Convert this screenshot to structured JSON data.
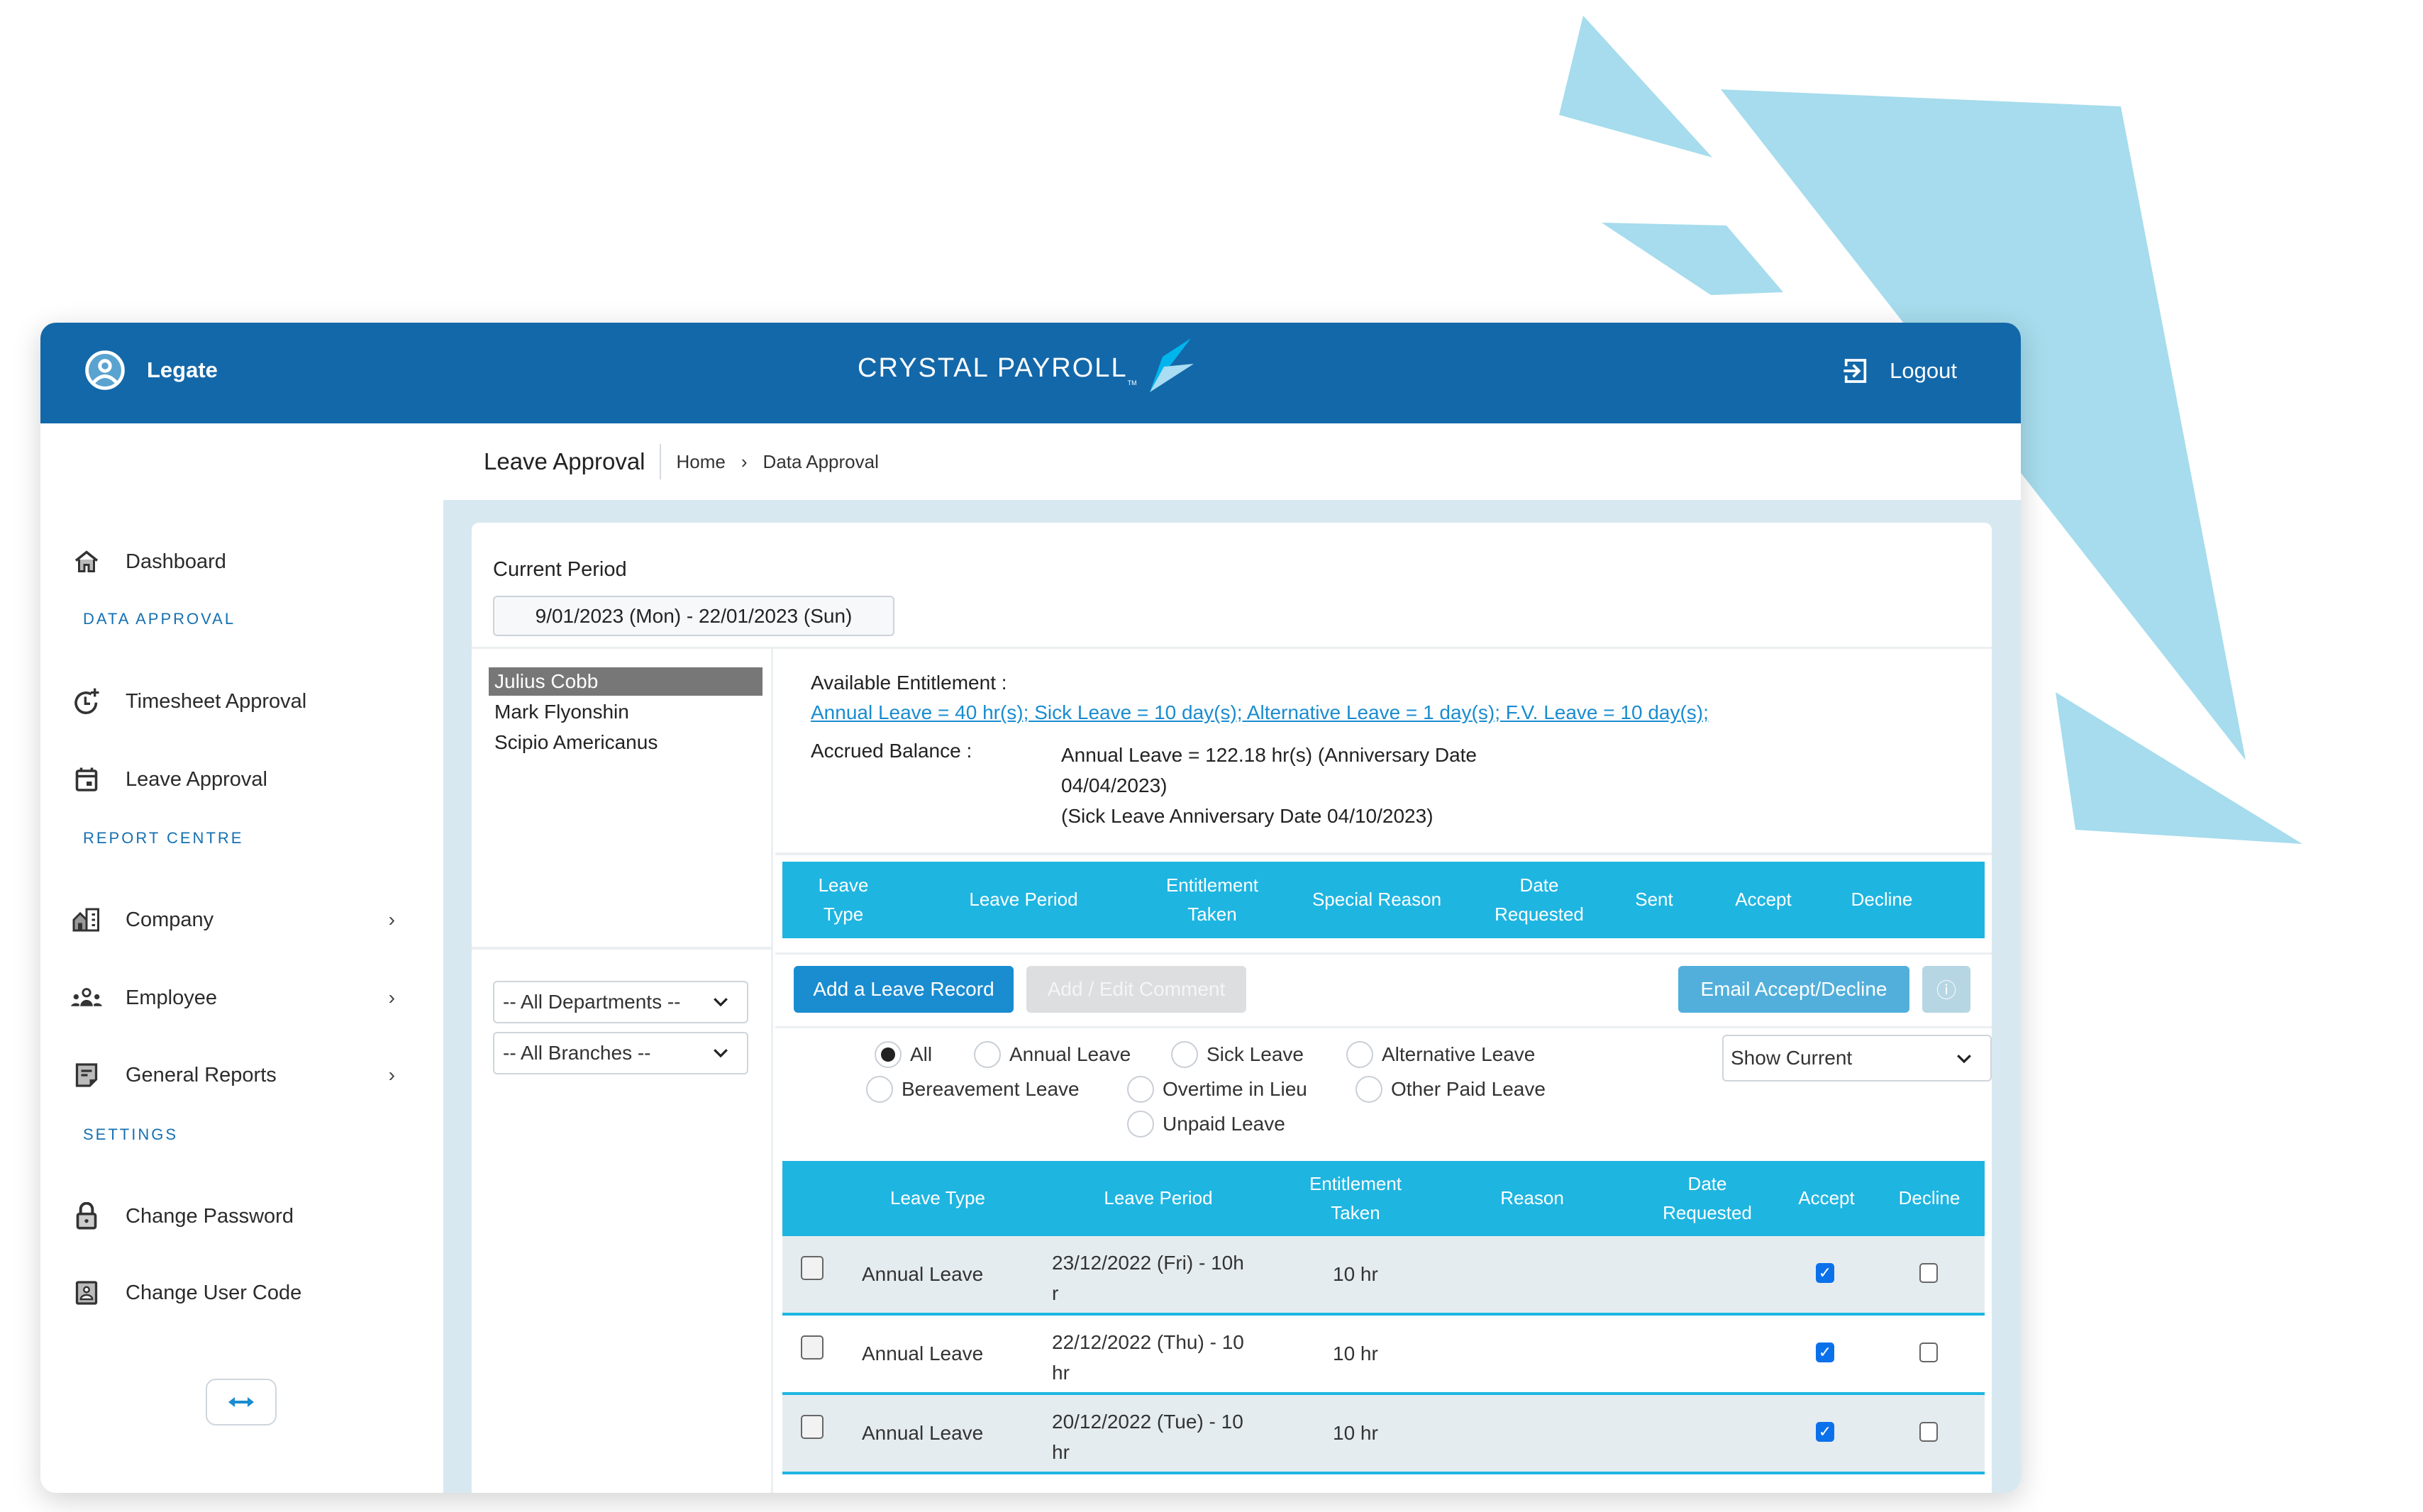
{
  "header": {
    "user_name": "Legate",
    "logo_text": "CRYSTAL PAYROLL",
    "logo_tm": "TM",
    "logout_label": "Logout",
    "brand_color": "#1368a9"
  },
  "sidebar": {
    "items": [
      {
        "label": "Dashboard",
        "icon": "home-icon"
      },
      {
        "section": "DATA APPROVAL"
      },
      {
        "label": "Timesheet Approval",
        "icon": "clock-plus-icon"
      },
      {
        "label": "Leave Approval",
        "icon": "calendar-icon"
      },
      {
        "section": "REPORT CENTRE"
      },
      {
        "label": "Company",
        "icon": "building-icon",
        "chevron": "›"
      },
      {
        "label": "Employee",
        "icon": "people-icon",
        "chevron": "›"
      },
      {
        "label": "General Reports",
        "icon": "report-icon",
        "chevron": "›"
      },
      {
        "section": "SETTINGS"
      },
      {
        "label": "Change Password",
        "icon": "lock-icon"
      },
      {
        "label": "Change User Code",
        "icon": "user-badge-icon"
      }
    ],
    "collapse_icon": "↔"
  },
  "breadcrumb": {
    "title": "Leave Approval",
    "home": "Home",
    "separator": "›",
    "current": "Data Approval"
  },
  "period": {
    "label": "Current Period",
    "value": "9/01/2023 (Mon) - 22/01/2023 (Sun)"
  },
  "employees": [
    {
      "name": "Julius Cobb",
      "selected": true
    },
    {
      "name": "Mark Flyonshin",
      "selected": false
    },
    {
      "name": "Scipio Americanus",
      "selected": false
    }
  ],
  "filters": {
    "department": "-- All Departments --",
    "branch": "-- All Branches --"
  },
  "entitlement": {
    "label": "Available Entitlement :",
    "link": "Annual Leave = 40 hr(s); Sick Leave = 10 day(s); Alternative Leave = 1 day(s); F.V. Leave = 10 day(s);",
    "accrued_label": "Accrued Balance :",
    "accrued_lines": [
      "Annual Leave = 122.18 hr(s) (Anniversary Date",
      "04/04/2023)",
      "(Sick Leave Anniversary Date 04/10/2023)"
    ]
  },
  "pending_table": {
    "headers": [
      "Leave Type",
      "Leave Period",
      "Entitlement Taken",
      "Special Reason",
      "Date Requested",
      "Sent",
      "Accept",
      "Decline"
    ],
    "header_lines": [
      [
        "Leave",
        "Type"
      ],
      [
        "Leave Period"
      ],
      [
        "Entitlement",
        "Taken"
      ],
      [
        "Special Reason"
      ],
      [
        "Date",
        "Requested"
      ],
      [
        "Sent"
      ],
      [
        "Accept"
      ],
      [
        "Decline"
      ]
    ]
  },
  "buttons": {
    "add_leave": "Add a Leave Record",
    "add_comment": "Add / Edit Comment",
    "email": "Email Accept/Decline",
    "info_icon": "ⓘ"
  },
  "leave_filter": {
    "options": [
      "All",
      "Annual Leave",
      "Sick Leave",
      "Alternative Leave",
      "Bereavement Leave",
      "Overtime in Lieu",
      "Other Paid Leave",
      "Unpaid Leave"
    ],
    "selected": "All",
    "show": "Show Current"
  },
  "history_table": {
    "header_lines": [
      [
        "Leave Type"
      ],
      [
        "Leave Period"
      ],
      [
        "Entitlement",
        "Taken"
      ],
      [
        "Reason"
      ],
      [
        "Date",
        "Requested"
      ],
      [
        "Accept"
      ],
      [
        "Decline"
      ]
    ],
    "rows": [
      {
        "selected": false,
        "leave_type": "Annual Leave",
        "period_l1": "23/12/2022 (Fri) - 10h",
        "period_l2": "r",
        "taken": "10 hr",
        "reason": "",
        "date_requested": "",
        "accept": true,
        "decline": false
      },
      {
        "selected": false,
        "leave_type": "Annual Leave",
        "period_l1": "22/12/2022 (Thu) - 10",
        "period_l2": "hr",
        "taken": "10 hr",
        "reason": "",
        "date_requested": "",
        "accept": true,
        "decline": false
      },
      {
        "selected": false,
        "leave_type": "Annual Leave",
        "period_l1": "20/12/2022 (Tue) - 10",
        "period_l2": "hr",
        "taken": "10 hr",
        "reason": "",
        "date_requested": "",
        "accept": true,
        "decline": false
      }
    ]
  },
  "colors": {
    "table_header": "#1eb5e1",
    "primary_button": "#1a8cd0",
    "email_button": "#52afdb",
    "disabled_button": "#dcdee0",
    "link": "#1a8cd0",
    "section": "#1570b2",
    "checkbox_checked": "#0b71eb"
  }
}
